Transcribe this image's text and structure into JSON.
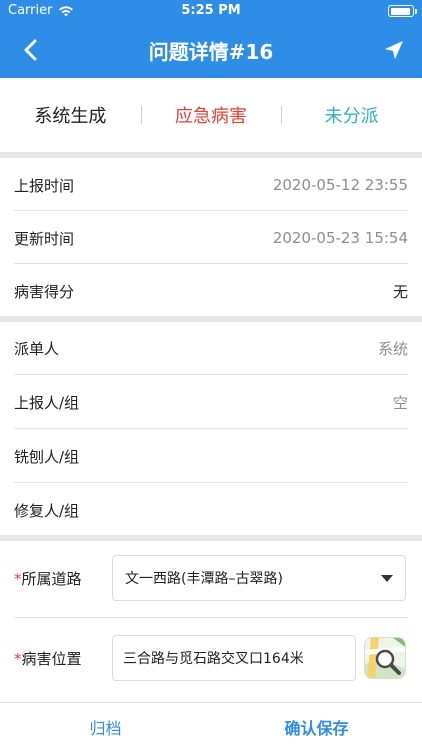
{
  "status_bar": {
    "carrier": "Carrier",
    "time": "5:25 PM"
  },
  "nav": {
    "title": "问题详情#16"
  },
  "tags": {
    "source": "系统生成",
    "category": "应急病害",
    "assignment": "未分派"
  },
  "info": {
    "report_time": {
      "label": "上报时间",
      "value": "2020-05-12 23:55"
    },
    "update_time": {
      "label": "更新时间",
      "value": "2020-05-23 15:54"
    },
    "score": {
      "label": "病害得分",
      "value": "无"
    }
  },
  "people": {
    "dispatcher": {
      "label": "派单人",
      "value": "系统"
    },
    "reporter": {
      "label": "上报人/组",
      "value": "空"
    },
    "milling": {
      "label": "铣刨人/组",
      "value": ""
    },
    "repair": {
      "label": "修复人/组",
      "value": ""
    }
  },
  "form": {
    "required_mark": "*",
    "road": {
      "label": "所属道路",
      "value": "文一西路(丰潭路–古翠路)"
    },
    "location": {
      "label": "病害位置",
      "value": "三合路与觅石路交叉口164米"
    }
  },
  "actions": {
    "archive": "归档",
    "confirm_save": "确认保存"
  },
  "colors": {
    "primary": "#2e8de6",
    "danger": "#e0423a",
    "teal": "#2cb3c8"
  }
}
